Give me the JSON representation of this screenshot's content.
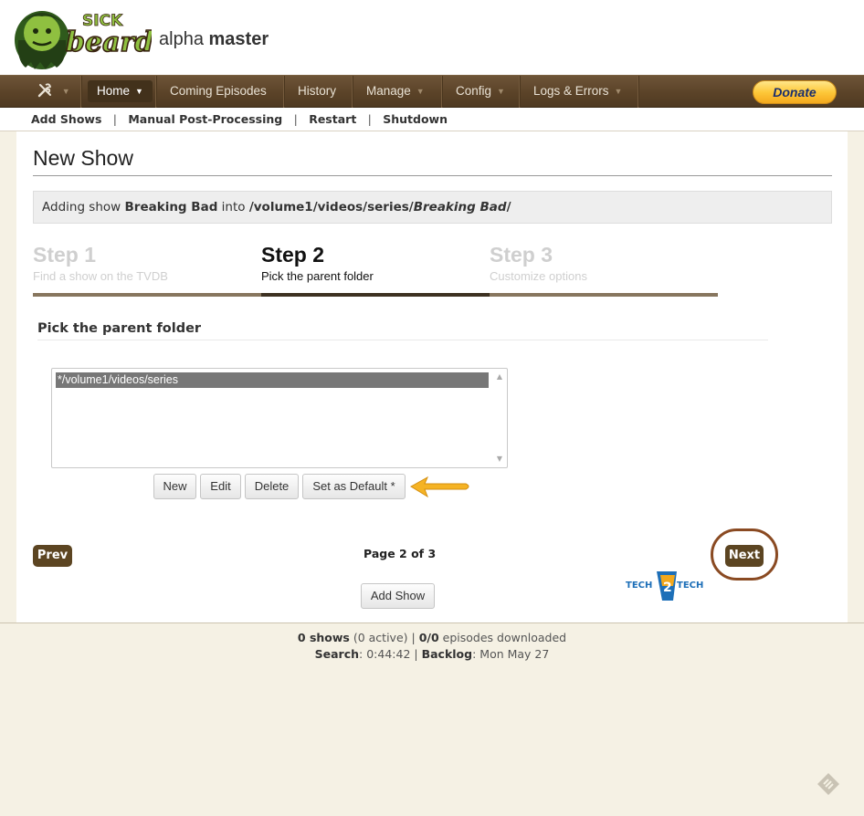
{
  "header": {
    "logo_top": "SICK",
    "logo_bottom": "beard",
    "branch_prefix": "alpha",
    "branch_name": "master"
  },
  "nav": {
    "items": [
      {
        "label": "Home"
      },
      {
        "label": "Coming Episodes"
      },
      {
        "label": "History"
      },
      {
        "label": "Manage"
      },
      {
        "label": "Config"
      },
      {
        "label": "Logs & Errors"
      }
    ],
    "donate_label": "Donate"
  },
  "submenu": {
    "items": [
      "Add Shows",
      "Manual Post-Processing",
      "Restart",
      "Shutdown"
    ],
    "separator": "|"
  },
  "page": {
    "title": "New Show",
    "adding": {
      "prefix": "Adding show",
      "show_name": "Breaking Bad",
      "middle": "into",
      "path_root": "/volume1/videos/series/",
      "path_show": "Breaking Bad",
      "path_suffix": "/"
    },
    "steps": [
      {
        "title": "Step 1",
        "desc": "Find a show on the TVDB"
      },
      {
        "title": "Step 2",
        "desc": "Pick the parent folder"
      },
      {
        "title": "Step 3",
        "desc": "Customize options"
      }
    ],
    "section_title": "Pick the parent folder",
    "folders": [
      "*/volume1/videos/series"
    ],
    "buttons": {
      "new": "New",
      "edit": "Edit",
      "delete": "Delete",
      "set_default": "Set as Default *",
      "prev": "Prev",
      "next": "Next",
      "add_show": "Add Show"
    },
    "page_indicator": "Page 2 of 3",
    "watermark": {
      "left": "TECH",
      "mid": "2",
      "right": "TECH"
    }
  },
  "footer": {
    "shows_count": "0 shows",
    "active": "(0 active)",
    "episodes": "0/0",
    "episodes_label": "episodes downloaded",
    "search_label": "Search",
    "search_time": "0:44:42",
    "backlog_label": "Backlog",
    "backlog_date": "Mon May 27"
  },
  "colors": {
    "nav_bg": "#5b4328",
    "accent_brown": "#5c4522",
    "donate": "#fdc83a",
    "arrow": "#f5b324"
  }
}
